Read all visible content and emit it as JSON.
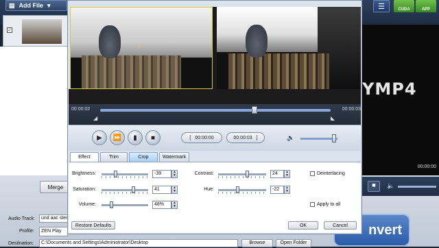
{
  "toolbar": {
    "add_file": "Add File"
  },
  "badges": [
    "CUDA",
    "APP"
  ],
  "logo": "YMP4",
  "right_panel": {
    "time": "00:00:00"
  },
  "main": {
    "merge": "Merge",
    "audio_track_label": "Audio Track:",
    "audio_track_value": "und aac ster",
    "profile_label": "Profile:",
    "profile_value": "ZEN Play",
    "destination_label": "Destination:",
    "destination_value": "C:\\Documents and Settings\\Administrator\\Desktop",
    "browse": "Browse",
    "open_folder": "Open Folder",
    "convert": "nvert"
  },
  "player": {
    "time_start": "00:00:02",
    "time_end": "00:00:03",
    "start_box": "00:00:00",
    "end_box": "00:00:03",
    "seek_fraction": 0.67,
    "volume_fraction": 0.9
  },
  "tabs": [
    "Effect",
    "Trim",
    "Crop",
    "Watermark"
  ],
  "effect": {
    "brightness_label": "Brightness:",
    "brightness_value": "-39",
    "saturation_label": "Saturation:",
    "saturation_value": "41",
    "volume_label": "Volume:",
    "volume_value": "48%",
    "contrast_label": "Contrast:",
    "contrast_value": "24",
    "hue_label": "Hue:",
    "hue_value": "-22",
    "deinterlacing_label": "Deinterlacing",
    "apply_all_label": "Apply to all",
    "restore_defaults": "Restore Defaults",
    "ok": "OK",
    "cancel": "Cancel"
  },
  "colors": {
    "accent": "#2b5ba8",
    "crop_tab": "#a9cdf2",
    "crop_border": "#d9c83a"
  }
}
